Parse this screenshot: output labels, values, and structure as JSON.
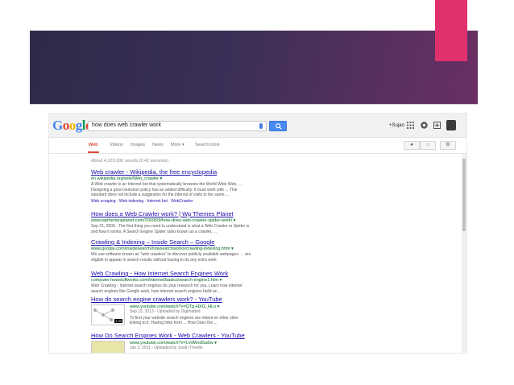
{
  "colors": {
    "banner_start": "#2e2a48",
    "banner_end": "#6a2f63",
    "accent_pink": "#e0306e",
    "link": "#1a0dab",
    "url": "#006621",
    "active_tab": "#dd4b39"
  },
  "google": {
    "logo": [
      "G",
      "o",
      "o",
      "g",
      "l",
      "e"
    ],
    "logo_colors": [
      "#4285f4",
      "#dd4b39",
      "#f4b400",
      "#4285f4",
      "#0f9d58",
      "#dd4b39"
    ],
    "query": "how does web crawler work",
    "user": "+Sujan"
  },
  "tabs": [
    "Web",
    "Videos",
    "Images",
    "News",
    "More ▾",
    "Search tools"
  ],
  "stats": "About 4,220,000 results (0.42 seconds)",
  "results": [
    {
      "title": "Web crawler - Wikipedia, the free encyclopedia",
      "url": "en.wikipedia.org/wiki/Web_crawler ▾",
      "snippet": "A Web crawler is an Internet bot that systematically browses the World Wide Web, ... Designing a good selection policy has an added difficulty: it must work with ... This standard does not include a suggestion for the interval of visits to the same ...",
      "links": "Web scraping · Web indexing · Internet bot · WebCrawler"
    },
    {
      "title": "How does a Web Crawler work? | Wp Themes Planet",
      "url": "www.wpthemesplanet.com/2009/09/how-does-web-crawler-spider-work/ ▾",
      "snippet": "Sep 21, 2009 - The first thing you need to understand is what a Web Crawler or Spider is and how it works. A Search Engine Spider (also known as a crawler, ..."
    },
    {
      "title": "Crawling & Indexing – Inside Search – Google",
      "url": "www.google.com/insidesearch/howsearchworks/crawling-indexing.html ▾",
      "snippet": "We use software known as \"web crawlers\" to discover publicly available webpages. ... are eligible to appear in search results without having to do any extra work."
    },
    {
      "title": "Web Crawling - How Internet Search Engines Work",
      "url": "computer.howstuffworks.com/internet/basics/search-engine1.htm ▾",
      "snippet": "Web Crawling - Internet search engines do your research for you. Learn how internet search engines like Google work, how internet search engines build an ..."
    },
    {
      "title": "How do search engine crawlers work? - YouTube",
      "url": "www.youtube.com/watch?v=QTg-HXG_HLo ▾",
      "meta": "Sep 15, 2013 - Uploaded by Digimatted",
      "snippet": "To find your website search engines are reliant on other sites linking to it. Having links from ... How Does the ...",
      "duration": "1:30"
    },
    {
      "title": "How Do Search Engines Work - Web Crawlers - YouTube",
      "url": "www.youtube.com/watch?v=LVdWxdSa0w ▾",
      "meta": "Jan 3, 2011 - Uploaded by Justin Trivette"
    }
  ]
}
